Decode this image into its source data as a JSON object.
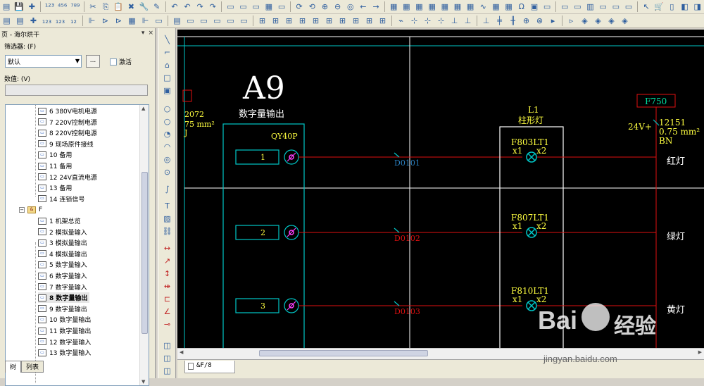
{
  "toolbar_icons_row1": [
    "new-doc-icon",
    "save-icon",
    "green-puzzle-icon",
    "seq-123-icon",
    "seq-456-icon",
    "seq-789-icon",
    "cut-icon",
    "copy-icon",
    "paste-icon",
    "delete-icon",
    "wrench-icon",
    "brush-icon",
    "undo-icon",
    "undo-2-icon",
    "redo-icon",
    "redo-2-icon",
    "page-icon",
    "page-2-icon",
    "page-3-icon",
    "table-icon",
    "page-4-icon",
    "refresh-icon",
    "rotate-icon",
    "zoom-in-icon",
    "zoom-out-icon",
    "zoom-100-icon",
    "back-arrow-icon",
    "forward-arrow-icon",
    "grid-icon",
    "grid-2-icon",
    "grid-3-icon",
    "grid-4-icon",
    "grid-5-icon",
    "grid-6-icon",
    "grid-7-icon",
    "wave-icon",
    "grid-8-icon",
    "grid-9-icon",
    "magnet-icon",
    "symbol-icon",
    "window-icon",
    "window-2-icon",
    "window-3-icon",
    "chart-icon",
    "window-4-icon",
    "window-5-icon",
    "window-6-icon",
    "cursor-icon",
    "cart-icon",
    "ruler-icon",
    "misc-icon",
    "misc-2-icon"
  ],
  "panel": {
    "title": "页 - 海尔烘干",
    "filter_label": "筛选器: (F)",
    "filter_value": "默认",
    "dots_label": "...",
    "activate_label": "激活",
    "value_label": "数值: (V)"
  },
  "tree": {
    "items_top": [
      {
        "label": "6 380V电机电源"
      },
      {
        "label": "7 220V控制电源"
      },
      {
        "label": "8 220V控制电源"
      },
      {
        "label": "9 现场原件接线"
      },
      {
        "label": "10 备用"
      },
      {
        "label": "11 备用"
      },
      {
        "label": "12 24V直流电源"
      },
      {
        "label": "13 备用"
      },
      {
        "label": "14 连锁信号"
      }
    ],
    "folder": {
      "label": "F",
      "expander": "−"
    },
    "items_f": [
      {
        "label": "1 机架总览"
      },
      {
        "label": "2 模拟量输入"
      },
      {
        "label": "3 模拟量输出"
      },
      {
        "label": "4 模拟量输出"
      },
      {
        "label": "5 数字量输入"
      },
      {
        "label": "6 数字量输入"
      },
      {
        "label": "7 数字量输入"
      },
      {
        "label": "8 数字量输出",
        "selected": true
      },
      {
        "label": "9 数字量输出"
      },
      {
        "label": "10 数字量输出"
      },
      {
        "label": "11 数字量输出"
      },
      {
        "label": "12 数字量输入"
      },
      {
        "label": "13 数字量输入"
      }
    ]
  },
  "panel_tabs": [
    "树",
    "列表"
  ],
  "page_tab": "&F/8",
  "schematic": {
    "module_name": "A9",
    "module_desc": "数字量输出",
    "module_type": "QY40P",
    "channels": [
      {
        "num": "1",
        "wire": "D0101"
      },
      {
        "num": "2",
        "wire": "D0102"
      },
      {
        "num": "3",
        "wire": "D0103"
      }
    ],
    "lamp_group_ref": "L1",
    "lamp_group_desc": "柱形灯",
    "lamps": [
      {
        "tag": "F803LT1",
        "x1": "x1",
        "x2": "x2",
        "desc": "红灯"
      },
      {
        "tag": "F807LT1",
        "x1": "x1",
        "x2": "x2",
        "desc": "绿灯"
      },
      {
        "tag": "F810LT1",
        "x1": "x1",
        "x2": "x2",
        "desc": "黄灯"
      }
    ],
    "left_edge_num": "2072",
    "left_edge_size": "75 mm²",
    "left_edge_extra": "J",
    "right_ref": "F750",
    "right_volt": "24V+",
    "right_wire": "12151",
    "right_size": "0.75 mm²",
    "right_color": "BN",
    "colors": {
      "background": "#000000",
      "frame": "#00c8c8",
      "wire": "#e01010",
      "text": "#ffff40",
      "white": "#ffffff",
      "magenta": "#ff40ff"
    }
  },
  "watermark": {
    "logo": "Bai",
    "logo_cn": "经验",
    "url": "jingyan.baidu.com"
  }
}
